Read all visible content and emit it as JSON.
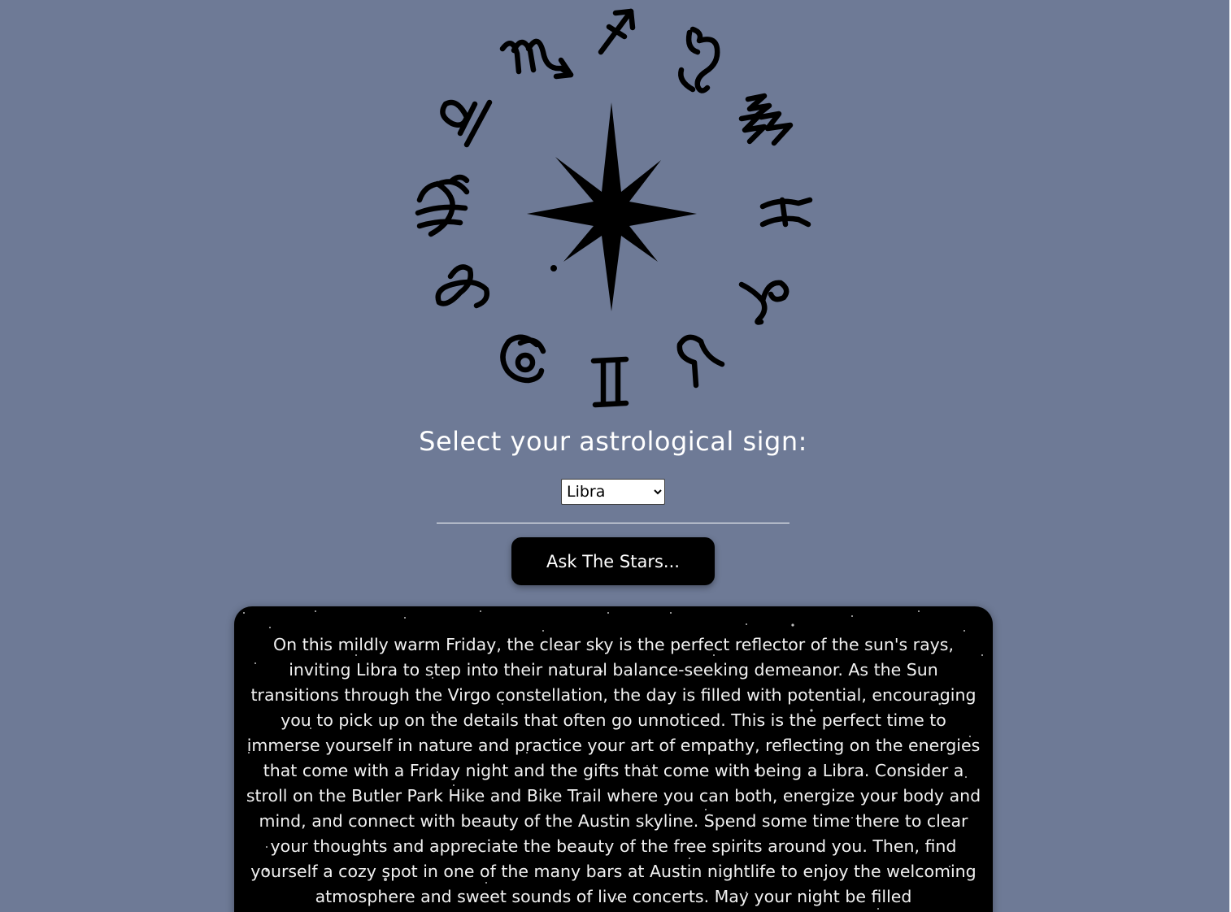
{
  "zodiac_wheel": {
    "center_icon": "eight-point-star-icon",
    "signs": [
      "aries",
      "taurus",
      "gemini",
      "cancer",
      "leo",
      "virgo",
      "libra",
      "scorpio",
      "sagittarius",
      "capricorn",
      "aquarius",
      "pisces"
    ]
  },
  "form": {
    "prompt": "Select your astrological sign:",
    "selected_sign": "Libra",
    "button_label": "Ask The Stars..."
  },
  "reading": {
    "text": "On this mildly warm Friday, the clear sky is the perfect reflector of the sun's rays, inviting Libra to step into their natural balance-seeking demeanor. As the Sun transitions through the Virgo constellation, the day is filled with potential, encouraging you to pick up on the details that often go unnoticed. This is the perfect time to immerse yourself in nature and practice your art of empathy, reflecting on the energies that come with a Friday night and the gifts that come with being a Libra. Consider a stroll on the Butler Park Hike and Bike Trail where you can both, energize your body and mind, and connect with beauty of the Austin skyline. Spend some time there to clear your thoughts and appreciate the beauty of the free spirits around you. Then, find yourself a cozy spot in one of the many bars at Austin nightlife to enjoy the welcoming atmosphere and sweet sounds of live concerts. May your night be filled"
  },
  "colors": {
    "background": "#6e7a96",
    "card": "#000000",
    "button": "#000000",
    "text": "#ffffff"
  }
}
